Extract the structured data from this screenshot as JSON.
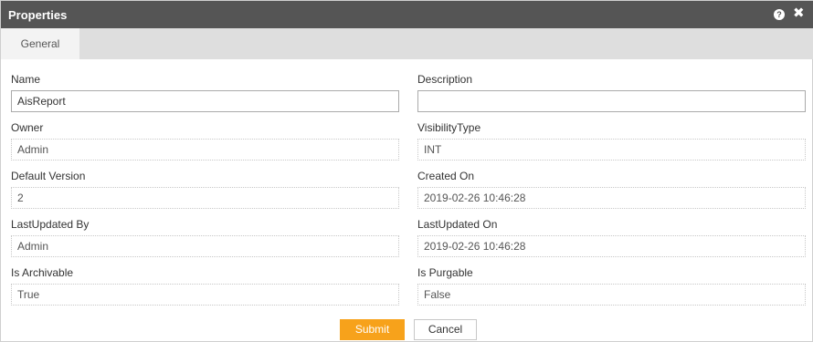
{
  "dialog": {
    "title": "Properties",
    "help_icon": "help-icon",
    "close_icon": "close-icon",
    "help_glyph": "?",
    "close_glyph": "✖"
  },
  "tabs": [
    {
      "label": "General",
      "active": true
    }
  ],
  "form": {
    "name": {
      "label": "Name",
      "value": "AisReport"
    },
    "description": {
      "label": "Description",
      "value": ""
    },
    "owner": {
      "label": "Owner",
      "value": "Admin"
    },
    "visibility_type": {
      "label": "VisibilityType",
      "value": "INT"
    },
    "default_version": {
      "label": "Default Version",
      "value": "2"
    },
    "created_on": {
      "label": "Created On",
      "value": "2019-02-26 10:46:28"
    },
    "last_updated_by": {
      "label": "LastUpdated By",
      "value": "Admin"
    },
    "last_updated_on": {
      "label": "LastUpdated On",
      "value": "2019-02-26 10:46:28"
    },
    "is_archivable": {
      "label": "Is Archivable",
      "value": "True"
    },
    "is_purgable": {
      "label": "Is Purgable",
      "value": "False"
    }
  },
  "buttons": {
    "submit": "Submit",
    "cancel": "Cancel"
  },
  "colors": {
    "titlebar": "#555555",
    "tabbar": "#dedede",
    "submit": "#f7a21b"
  }
}
